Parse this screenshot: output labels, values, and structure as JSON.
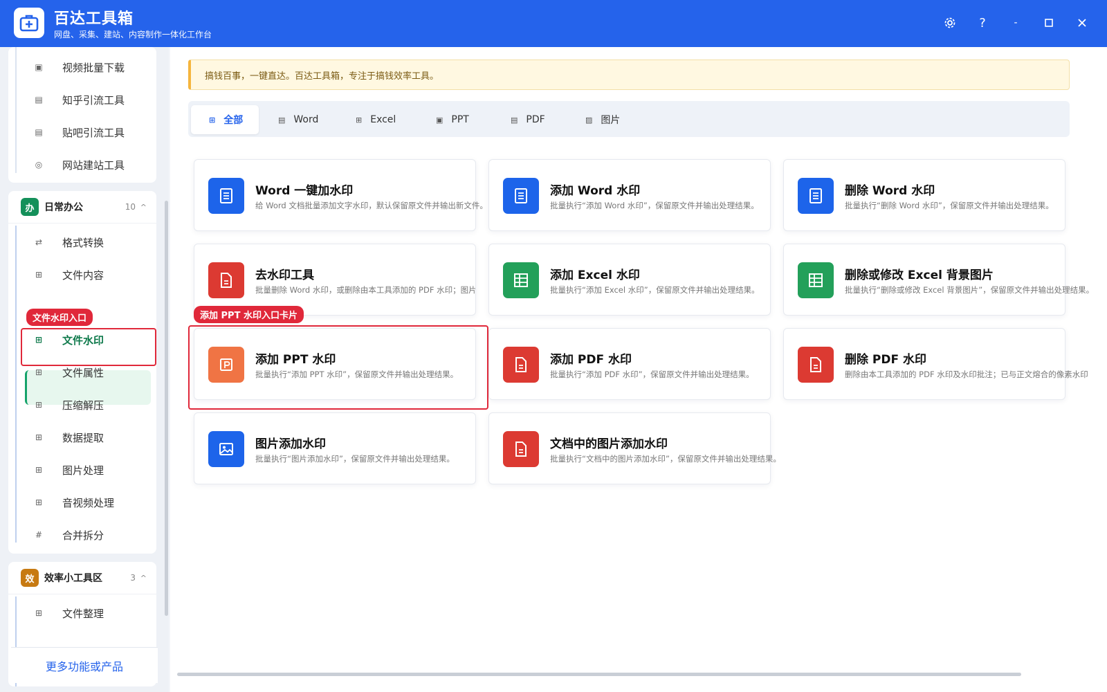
{
  "app": {
    "title": "百达工具箱",
    "subtitle": "网盘、采集、建站、内容制作一体化工作台"
  },
  "window_controls": [
    "settings-icon",
    "help-icon",
    "minimize-icon",
    "maximize-icon",
    "close-icon"
  ],
  "sidebar": {
    "top_items": [
      {
        "label": "视频批量下载",
        "icon": "video-icon"
      },
      {
        "label": "知乎引流工具",
        "icon": "zhihu-icon"
      },
      {
        "label": "贴吧引流工具",
        "icon": "tieba-icon"
      },
      {
        "label": "网站建站工具",
        "icon": "website-icon"
      }
    ],
    "group_daily": {
      "badge": "办",
      "title": "日常办公",
      "count": "10",
      "caret": "^",
      "items": [
        {
          "label": "格式转换",
          "icon": "convert-icon"
        },
        {
          "label": "文件内容",
          "icon": "grid-icon"
        },
        {
          "label": "文件水印",
          "icon": "grid-icon",
          "active": true
        },
        {
          "label": "文件属性",
          "icon": "grid-icon"
        },
        {
          "label": "压缩解压",
          "icon": "grid-icon"
        },
        {
          "label": "数据提取",
          "icon": "grid-icon"
        },
        {
          "label": "图片处理",
          "icon": "grid-icon"
        },
        {
          "label": "音视频处理",
          "icon": "grid-icon"
        },
        {
          "label": "合并拆分",
          "icon": "hash-icon"
        }
      ]
    },
    "group_efficiency": {
      "badge": "效",
      "title": "效率小工具区",
      "count": "3",
      "caret": "^",
      "items": [
        {
          "label": "文件整理",
          "icon": "grid-icon"
        }
      ]
    },
    "more_label": "更多功能或产品",
    "annotation_tag": "文件水印入口"
  },
  "notice": "搞钱百事，一键直达。百达工具箱，专注于搞钱效率工具。",
  "tabs": [
    {
      "label": "全部",
      "icon": "grid-icon",
      "active": true
    },
    {
      "label": "Word",
      "icon": "doc-icon"
    },
    {
      "label": "Excel",
      "icon": "table-icon"
    },
    {
      "label": "PPT",
      "icon": "ppt-icon"
    },
    {
      "label": "PDF",
      "icon": "pdf-icon"
    },
    {
      "label": "图片",
      "icon": "image-icon"
    }
  ],
  "cards": [
    {
      "title": "Word 一键加水印",
      "desc": "给 Word 文档批量添加文字水印，默认保留原文件并输出新文件。",
      "icon": "word-doc-icon",
      "color": "#1d64ea"
    },
    {
      "title": "添加 Word 水印",
      "desc": "批量执行“添加 Word 水印”，保留原文件并输出处理结果。",
      "icon": "word-doc-icon",
      "color": "#1d64ea"
    },
    {
      "title": "删除 Word 水印",
      "desc": "批量执行“删除 Word 水印”，保留原文件并输出处理结果。",
      "icon": "word-doc-icon",
      "color": "#1d64ea"
    },
    {
      "title": "去水印工具",
      "desc": "批量删除 Word 水印，或删除由本工具添加的 PDF 水印；图片/格",
      "icon": "file-icon",
      "color": "#dc3a32"
    },
    {
      "title": "添加 Excel 水印",
      "desc": "批量执行“添加 Excel 水印”，保留原文件并输出处理结果。",
      "icon": "sheet-icon",
      "color": "#23a05a"
    },
    {
      "title": "删除或修改 Excel 背景图片",
      "desc": "批量执行“删除或修改 Excel 背景图片”，保留原文件并输出处理结果。",
      "icon": "sheet-icon",
      "color": "#23a05a"
    },
    {
      "title": "添加 PPT 水印",
      "desc": "批量执行“添加 PPT 水印”，保留原文件并输出处理结果。",
      "icon": "ppt-file-icon",
      "color": "#f07444"
    },
    {
      "title": "添加 PDF 水印",
      "desc": "批量执行“添加 PDF 水印”，保留原文件并输出处理结果。",
      "icon": "pdf-file-icon",
      "color": "#dc3a32"
    },
    {
      "title": "删除 PDF 水印",
      "desc": "删除由本工具添加的 PDF 水印及水印批注；已与正文熔合的像素水印",
      "icon": "pdf-file-icon",
      "color": "#dc3a32"
    },
    {
      "title": "图片添加水印",
      "desc": "批量执行“图片添加水印”，保留原文件并输出处理结果。",
      "icon": "picture-icon",
      "color": "#1d64ea"
    },
    {
      "title": "文档中的图片添加水印",
      "desc": "批量执行“文档中的图片添加水印”，保留原文件并输出处理结果。",
      "icon": "file-icon",
      "color": "#dc3a32"
    }
  ],
  "card_annotation_tag": "添加 PPT 水印入口卡片"
}
